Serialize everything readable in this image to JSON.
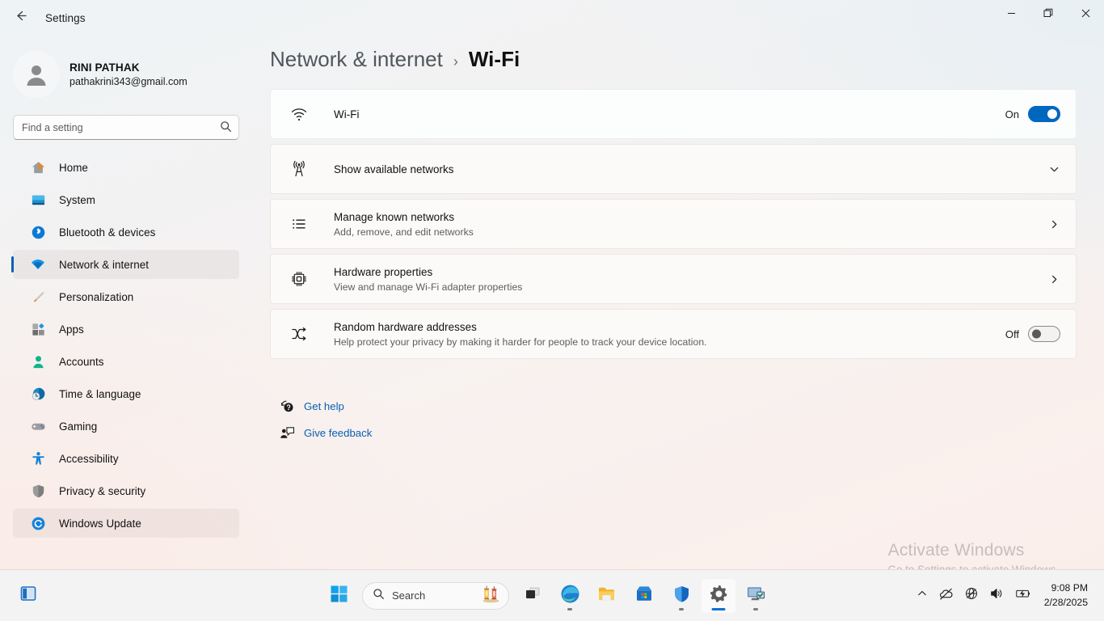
{
  "window": {
    "title": "Settings",
    "back_icon": "arrow-left-icon",
    "controls": {
      "minimize": "minimize-icon",
      "restore": "restore-icon",
      "close": "close-icon"
    }
  },
  "sidebar": {
    "profile": {
      "name": "RINI PATHAK",
      "email": "pathakrini343@gmail.com",
      "avatar_icon": "avatar-icon"
    },
    "search": {
      "placeholder": "Find a setting",
      "value": "",
      "icon": "search-icon"
    },
    "items": [
      {
        "label": "Home",
        "icon": "home-icon",
        "state": "normal"
      },
      {
        "label": "System",
        "icon": "system-icon",
        "state": "normal"
      },
      {
        "label": "Bluetooth & devices",
        "icon": "bluetooth-icon",
        "state": "normal"
      },
      {
        "label": "Network & internet",
        "icon": "wifi-icon",
        "state": "selected"
      },
      {
        "label": "Personalization",
        "icon": "brush-icon",
        "state": "normal"
      },
      {
        "label": "Apps",
        "icon": "apps-icon",
        "state": "normal"
      },
      {
        "label": "Accounts",
        "icon": "accounts-icon",
        "state": "normal"
      },
      {
        "label": "Time & language",
        "icon": "clock-globe-icon",
        "state": "normal"
      },
      {
        "label": "Gaming",
        "icon": "gamepad-icon",
        "state": "normal"
      },
      {
        "label": "Accessibility",
        "icon": "accessibility-icon",
        "state": "normal"
      },
      {
        "label": "Privacy & security",
        "icon": "shield-icon",
        "state": "normal"
      },
      {
        "label": "Windows Update",
        "icon": "update-icon",
        "state": "hovered"
      }
    ]
  },
  "main": {
    "breadcrumb": {
      "parent": "Network & internet",
      "separator": "›",
      "current": "Wi-Fi"
    },
    "cards": [
      {
        "title": "Wi-Fi",
        "subtitle": "",
        "icon": "wifi-icon",
        "control": "toggle",
        "toggle_state": "On"
      },
      {
        "title": "Show available networks",
        "subtitle": "",
        "icon": "broadcast-tower-icon",
        "control": "chevron-down",
        "toggle_state": ""
      },
      {
        "title": "Manage known networks",
        "subtitle": "Add, remove, and edit networks",
        "icon": "list-icon",
        "control": "chevron-right",
        "toggle_state": ""
      },
      {
        "title": "Hardware properties",
        "subtitle": "View and manage Wi-Fi adapter properties",
        "icon": "chip-icon",
        "control": "chevron-right",
        "toggle_state": ""
      },
      {
        "title": "Random hardware addresses",
        "subtitle": "Help protect your privacy by making it harder for people to track your device location.",
        "icon": "shuffle-icon",
        "control": "toggle",
        "toggle_state": "Off"
      }
    ],
    "links": [
      {
        "label": "Get help",
        "icon": "help-icon"
      },
      {
        "label": "Give feedback",
        "icon": "feedback-icon"
      }
    ],
    "watermark": {
      "title": "Activate Windows",
      "subtitle": "Go to Settings to activate Windows."
    }
  },
  "taskbar": {
    "widgets_icon": "widgets-icon",
    "start_icon": "start-icon",
    "search": {
      "placeholder": "Search",
      "icon": "search-icon",
      "decoration": "lantern-emoji"
    },
    "apps": [
      {
        "name": "task-view",
        "icon": "task-view-icon",
        "active": false,
        "running": false
      },
      {
        "name": "edge",
        "icon": "edge-icon",
        "active": false,
        "running": true
      },
      {
        "name": "file-explorer",
        "icon": "folder-icon",
        "active": false,
        "running": false
      },
      {
        "name": "microsoft-store",
        "icon": "store-icon",
        "active": false,
        "running": false
      },
      {
        "name": "windows-security",
        "icon": "shield-icon",
        "active": false,
        "running": true
      },
      {
        "name": "settings",
        "icon": "gear-icon",
        "active": true,
        "running": true
      },
      {
        "name": "remote-desktop",
        "icon": "remote-desktop-icon",
        "active": false,
        "running": true
      }
    ],
    "tray": {
      "chevron": "chevron-up-icon",
      "onedrive": "cloud-offline-icon",
      "network": "globe-no-internet-icon",
      "volume": "speaker-icon",
      "battery": "battery-charging-icon",
      "time": "9:08 PM",
      "date": "2/28/2025"
    }
  },
  "colors": {
    "accent": "#0067c0",
    "selection_bar": "#0a5fb4",
    "link": "#0a5fb4",
    "card_bg": "#fbfaf9",
    "taskbar_bg": "#f3f3f3"
  }
}
